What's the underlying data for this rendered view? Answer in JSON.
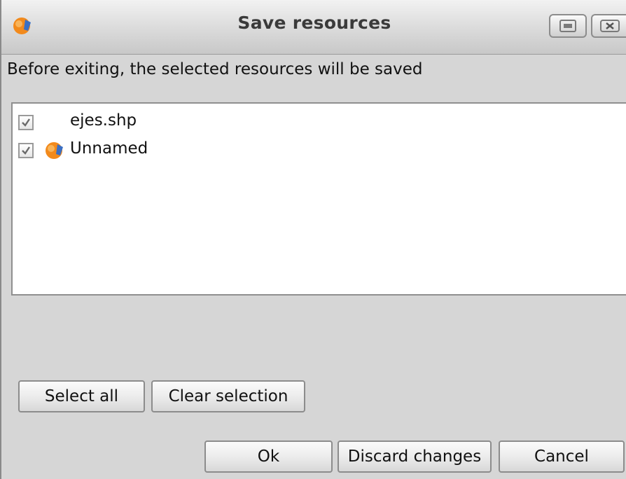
{
  "window": {
    "title": "Save resources",
    "app_icon": "gvsig-icon",
    "controls": {
      "restore_icon": "restore-icon",
      "close_icon": "close-icon"
    }
  },
  "message": "Before exiting, the selected resources will be saved",
  "resources": [
    {
      "label": "ejes.shp",
      "checked": true,
      "icon": null
    },
    {
      "label": "Unnamed",
      "checked": true,
      "icon": "gvsig-project-icon"
    }
  ],
  "buttons": {
    "select_all": "Select all",
    "clear_selection": "Clear selection",
    "ok": "Ok",
    "discard_changes": "Discard changes",
    "cancel": "Cancel"
  },
  "colors": {
    "icon_orange": "#f28a1c",
    "icon_blue": "#3a6fc4",
    "background": "#d6d6d6"
  }
}
